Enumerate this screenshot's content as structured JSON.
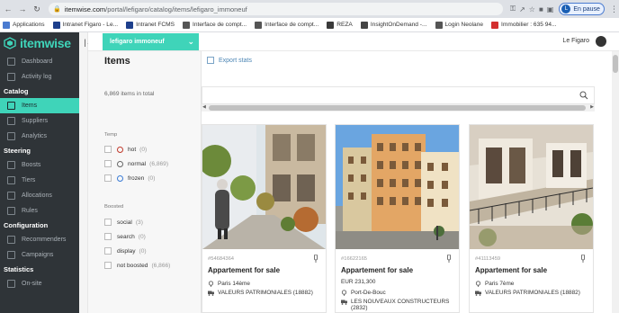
{
  "browser": {
    "url_host": "itemwise.com",
    "url_path": "/portal/lefigaro/catalog/items/lefigaro_immoneuf",
    "profile_initial": "L",
    "profile_status": "En pause",
    "bookmarks": [
      {
        "label": "Applications",
        "icon_color": "#4a7bd0"
      },
      {
        "label": "Intranet Figaro - Le...",
        "icon_color": "#1d3f8c"
      },
      {
        "label": "Intranet FCMS",
        "icon_color": "#1d3f8c"
      },
      {
        "label": "Interface de compt...",
        "icon_color": "#555555"
      },
      {
        "label": "Interface de compt...",
        "icon_color": "#555555"
      },
      {
        "label": "REZA",
        "icon_color": "#3a3a3a"
      },
      {
        "label": "InsightOnDemand -...",
        "icon_color": "#444444"
      },
      {
        "label": "Login Neolane",
        "icon_color": "#555555"
      },
      {
        "label": "Immobilier : 635 94...",
        "icon_color": "#d32f2f"
      }
    ]
  },
  "sidebar": {
    "logo": "itemwise",
    "accent": "#3fd4b9",
    "top_items": [
      {
        "label": "Dashboard",
        "icon": "dashboard-icon"
      },
      {
        "label": "Activity log",
        "icon": "activity-log-icon"
      }
    ],
    "sections": [
      {
        "title": "Catalog",
        "items": [
          {
            "label": "Items",
            "icon": "items-icon",
            "active": true
          },
          {
            "label": "Suppliers",
            "icon": "suppliers-icon"
          },
          {
            "label": "Analytics",
            "icon": "analytics-icon"
          }
        ]
      },
      {
        "title": "Steering",
        "items": [
          {
            "label": "Boosts",
            "icon": "boosts-icon"
          },
          {
            "label": "Tiers",
            "icon": "tiers-icon"
          },
          {
            "label": "Allocations",
            "icon": "allocations-icon"
          },
          {
            "label": "Rules",
            "icon": "rules-icon"
          }
        ]
      },
      {
        "title": "Configuration",
        "items": [
          {
            "label": "Recommenders",
            "icon": "recommenders-icon"
          },
          {
            "label": "Campaigns",
            "icon": "campaigns-icon"
          }
        ]
      },
      {
        "title": "Statistics",
        "items": [
          {
            "label": "On-site",
            "icon": "on-site-icon"
          }
        ]
      }
    ]
  },
  "topbar": {
    "catalog": "lefigaro immoneuf",
    "organization": "Le Figaro"
  },
  "main": {
    "title": "Items",
    "export_label": "Export stats",
    "count_text": "6,869 items in total",
    "filters": {
      "temp_title": "Temp",
      "temp": [
        {
          "label": "hot",
          "count": "(0)",
          "icon": "fire-icon"
        },
        {
          "label": "normal",
          "count": "(6,869)",
          "icon": "thermometer-icon"
        },
        {
          "label": "frozen",
          "count": "(0)",
          "icon": "snowflake-icon"
        }
      ],
      "boosts_title": "Boosted",
      "boosts": [
        {
          "label": "social",
          "count": "(3)"
        },
        {
          "label": "search",
          "count": "(0)"
        },
        {
          "label": "display",
          "count": "(0)"
        },
        {
          "label": "not boosted",
          "count": "(6,866)"
        }
      ]
    },
    "cards": [
      {
        "id": "#54684364",
        "title": "Appartement for sale",
        "price": "",
        "location": "Paris 14ème",
        "supplier": "VALEURS PATRIMONIALES (18882)"
      },
      {
        "id": "#16622165",
        "title": "Appartement for sale",
        "price": "EUR 231,300",
        "location": "Port-De-Bouc",
        "supplier": "LES NOUVEAUX CONSTRUCTEURS (2832)"
      },
      {
        "id": "#41113459",
        "title": "Appartement for sale",
        "price": "",
        "location": "Paris 7ème",
        "supplier": "VALEURS PATRIMONIALES (18882)"
      }
    ]
  }
}
